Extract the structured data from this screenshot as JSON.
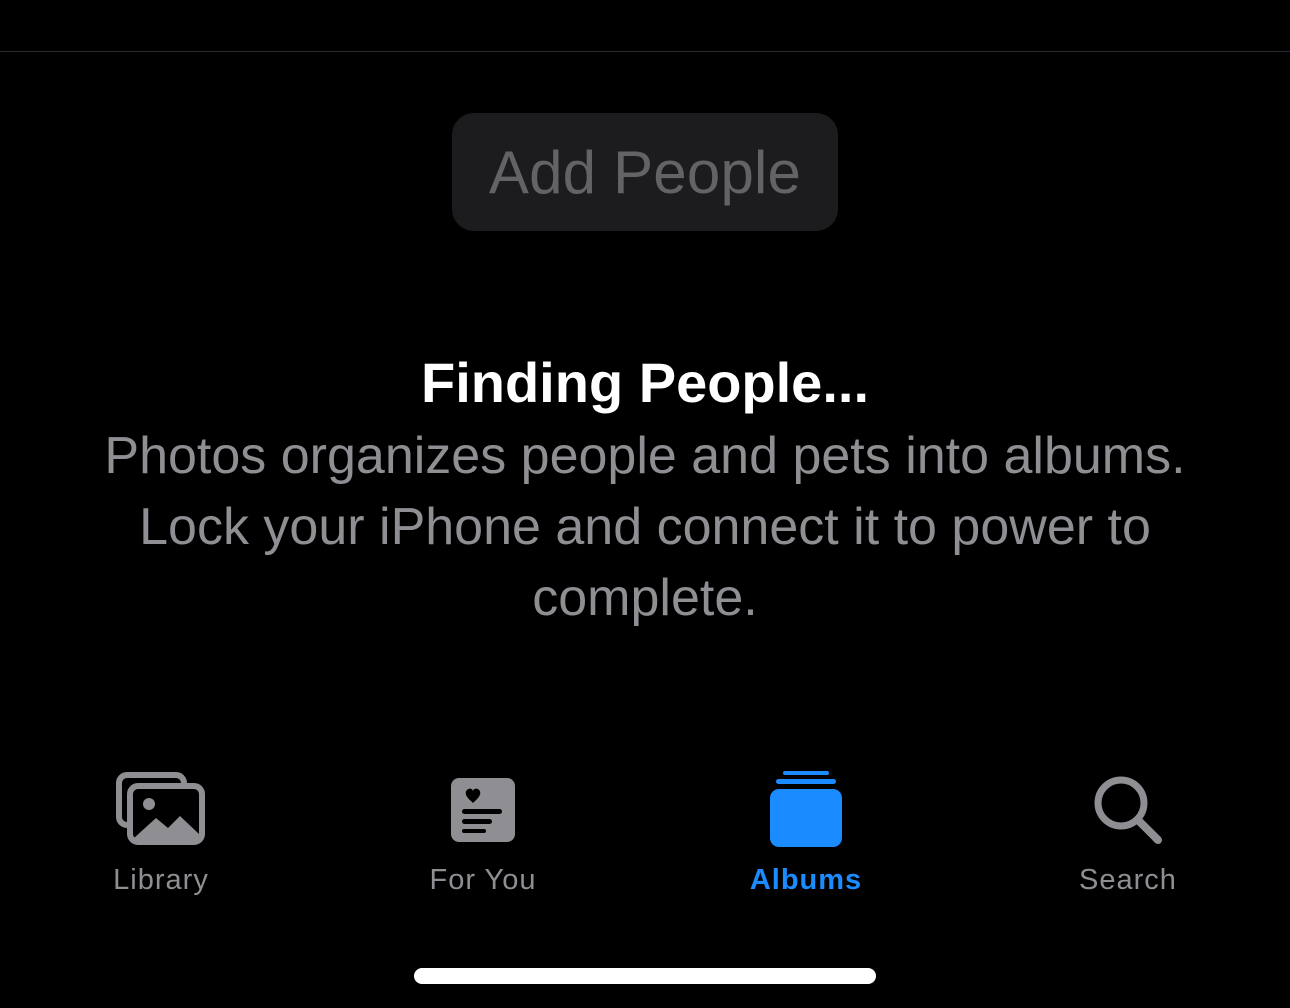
{
  "colors": {
    "background": "#000000",
    "button_background": "#1c1c1e",
    "button_text": "#636366",
    "title_text": "#ffffff",
    "secondary_text": "#8e8e93",
    "accent": "#1a8cff",
    "tab_inactive": "#8e8e93"
  },
  "add_people_button": {
    "label": "Add People"
  },
  "empty_state": {
    "title": "Finding People...",
    "description": "Photos organizes people and pets into albums. Lock your iPhone and connect it to power to complete."
  },
  "tab_bar": {
    "tabs": [
      {
        "label": "Library",
        "icon": "photo-stack-icon",
        "active": false
      },
      {
        "label": "For You",
        "icon": "heart-text-square-icon",
        "active": false
      },
      {
        "label": "Albums",
        "icon": "rectangle-stack-icon",
        "active": true
      },
      {
        "label": "Search",
        "icon": "magnifying-glass-icon",
        "active": false
      }
    ]
  }
}
